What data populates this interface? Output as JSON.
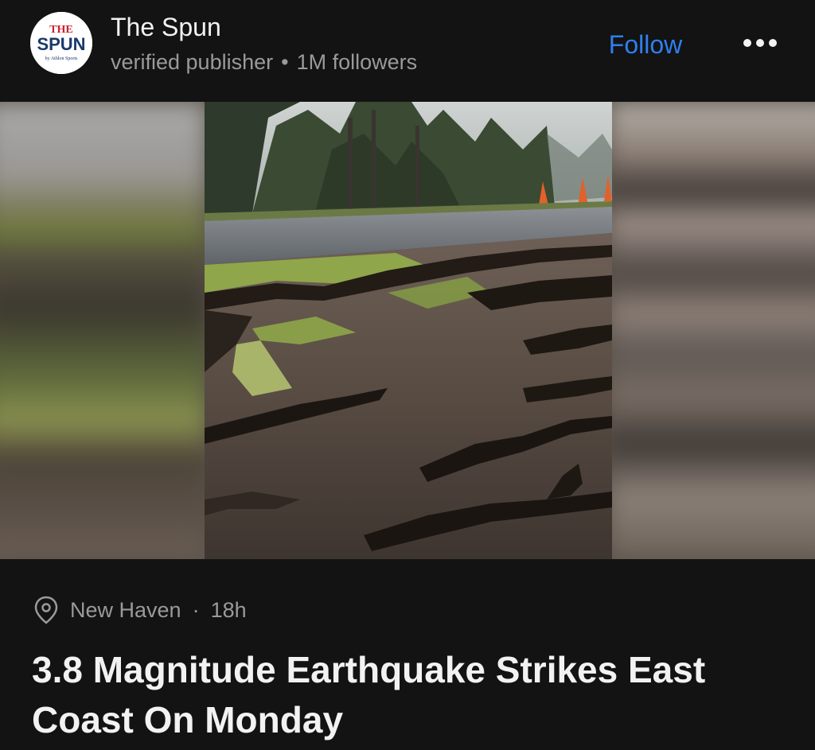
{
  "publisher": {
    "name": "The Spun",
    "badge": "verified publisher",
    "separator": "•",
    "followers": "1M followers",
    "logo_text": {
      "line1": "THE",
      "line2": "SPUN",
      "line3": "by Athlon Sports"
    }
  },
  "actions": {
    "follow_label": "Follow",
    "more_icon": "more-horizontal-icon"
  },
  "article": {
    "location": "New Haven",
    "separator": "·",
    "age": "18h",
    "location_icon": "location-pin-icon",
    "headline": "3.8 Magnitude Earthquake Strikes East Coast On Monday"
  },
  "colors": {
    "background": "#131313",
    "accent": "#2f7ff0",
    "logo_red": "#c8202f",
    "logo_navy": "#1a3a6b"
  }
}
